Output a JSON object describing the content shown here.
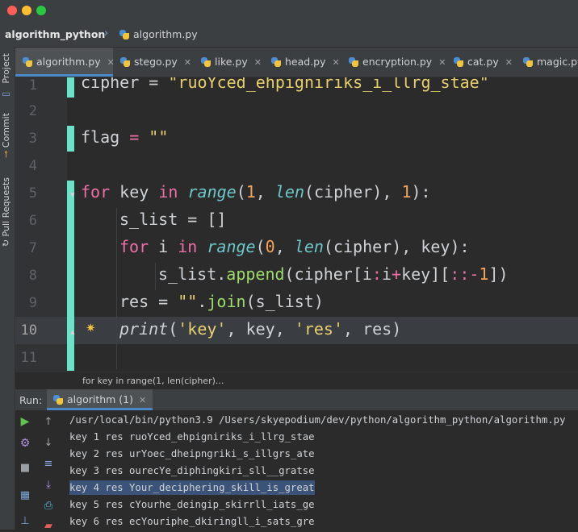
{
  "window": {
    "traffic_lights": {
      "close": "#ff5f57",
      "minimize": "#febc2e",
      "maximize": "#28c840"
    }
  },
  "navbar": {
    "project": "algorithm_python",
    "file": "algorithm.py"
  },
  "sidebar": {
    "project": "Project",
    "commit": "Commit",
    "pull_requests": "Pull Requests"
  },
  "tabs": [
    {
      "label": "algorithm.py",
      "active": true
    },
    {
      "label": "stego.py"
    },
    {
      "label": "like.py"
    },
    {
      "label": "head.py"
    },
    {
      "label": "encryption.py"
    },
    {
      "label": "cat.py"
    },
    {
      "label": "magic.py"
    }
  ],
  "editor": {
    "line_numbers": [
      "1",
      "2",
      "3",
      "4",
      "5",
      "6",
      "7",
      "8",
      "9",
      "10",
      "11"
    ],
    "current_line": "10",
    "line1": {
      "var": "cipher",
      "op": " = ",
      "str": "\"ruoYced_ehpigniriks_i_llrg_stae\""
    },
    "line3": {
      "var": "flag",
      "op": " = ",
      "str": "\"\""
    },
    "line5": {
      "kw_for": "for",
      "t1": " key ",
      "kw_in": "in",
      "sp": " ",
      "fn_range": "range",
      "p1": "(",
      "n1": "1",
      "c1": ", ",
      "fn_len": "len",
      "t2": "(cipher), ",
      "n2": "1",
      "end": "):"
    },
    "line6": {
      "text": "s_list = []"
    },
    "line7": {
      "kw_for": "for",
      "t1": " i ",
      "kw_in": "in",
      "sp": " ",
      "fn_range": "range",
      "p1": "(",
      "n1": "0",
      "c1": ", ",
      "fn_len": "len",
      "t2": "(cipher), key):"
    },
    "line8": {
      "t1": "s_list.",
      "meth": "append",
      "t2": "(cipher[i",
      "kw_colon": ":",
      "t3": "i",
      "kw_plus": "+",
      "t4": "key][",
      "kw_cc": "::",
      "kw_minus": "-",
      "n1": "1",
      "t5": "])"
    },
    "line9": {
      "t1": "res = ",
      "str": "\"\"",
      "t2": ".",
      "meth": "join",
      "t3": "(s_list)"
    },
    "line10": {
      "fn_print": "print",
      "p1": "(",
      "s1": "'key'",
      "t1": ", key, ",
      "s2": "'res'",
      "t2": ", res)"
    }
  },
  "breadcrumb": "for key in range(1, len(cipher)...",
  "run": {
    "label": "Run:",
    "tab": "algorithm (1)",
    "console": [
      "/usr/local/bin/python3.9 /Users/skyepodium/dev/python/algorithm_python/algorithm.py",
      "key 1 res ruoYced_ehpigniriks_i_llrg_stae",
      "key 2 res urYoec_dheipngriki_s_illgrs_ate",
      "key 3 res ourecYe_diphingkiri_sll__gratse",
      "key 4 res Your_deciphering_skill_is_great",
      "key 5 res cYourhe_deingip_skirrll_iats_ge",
      "key 6 res ecYouriphe_dkiringll_i_sats_gre"
    ],
    "selected_line": 4
  }
}
